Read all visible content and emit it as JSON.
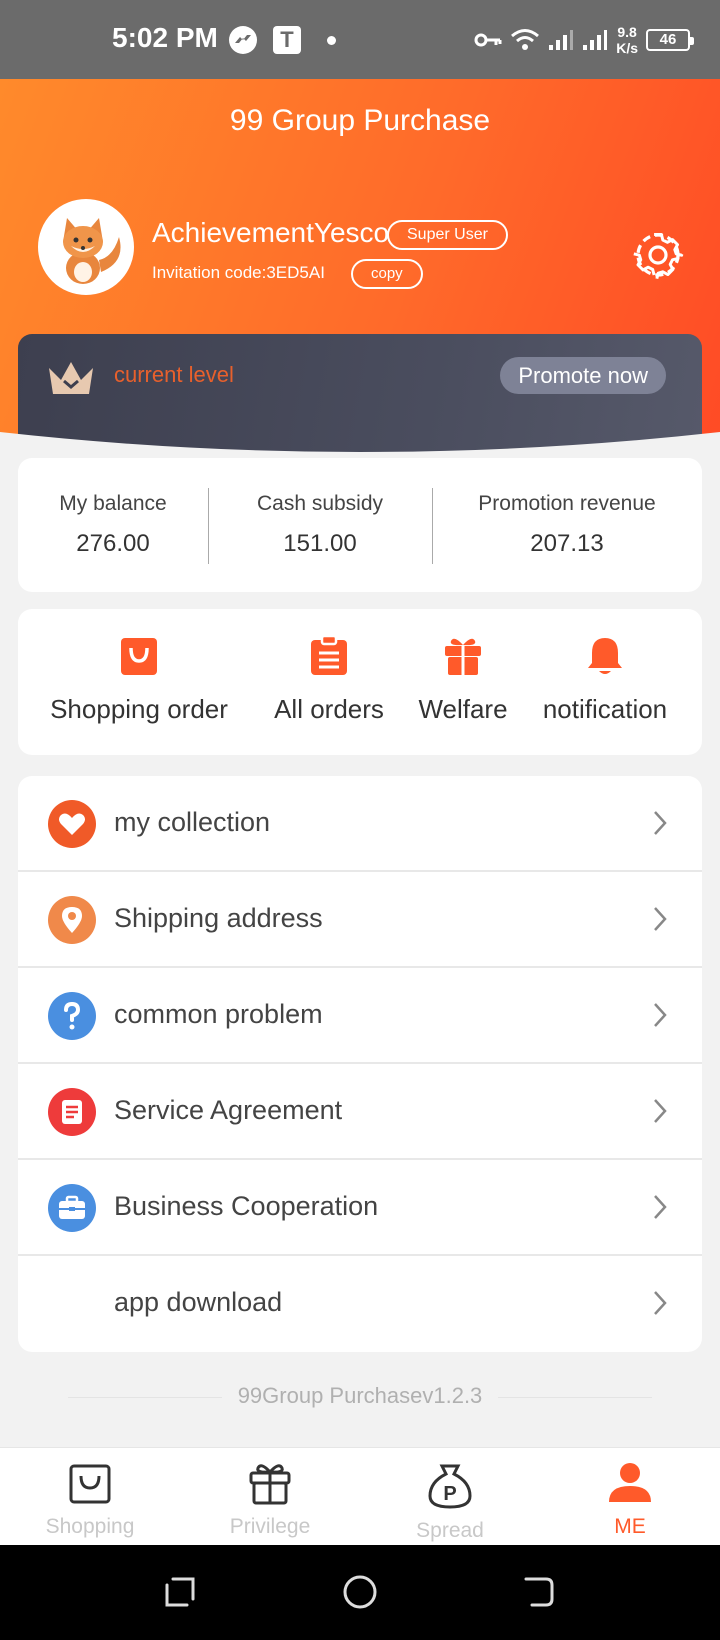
{
  "status_bar": {
    "time": "5:02 PM",
    "t_badge": "T",
    "net_speed_value": "9.8",
    "net_speed_unit": "K/s",
    "battery": "46"
  },
  "header": {
    "title": "99 Group Purchase",
    "username": "AchievementYesco",
    "user_badge": "Super User",
    "invitation_code": "Invitation code:3ED5AI",
    "copy_label": "copy"
  },
  "level_card": {
    "level_text": "current level",
    "promote_label": "Promote now"
  },
  "stats": [
    {
      "label": "My balance",
      "value": "276.00"
    },
    {
      "label": "Cash subsidy",
      "value": "151.00"
    },
    {
      "label": "Promotion revenue",
      "value": "207.13"
    }
  ],
  "shortcuts": [
    {
      "label": "Shopping order",
      "icon": "shopping-bag-icon"
    },
    {
      "label": "All orders",
      "icon": "clipboard-icon"
    },
    {
      "label": "Welfare",
      "icon": "gift-icon"
    },
    {
      "label": "notification",
      "icon": "bell-icon"
    }
  ],
  "menu": [
    {
      "label": "my collection",
      "icon": "heart-icon",
      "color": "#f05a28"
    },
    {
      "label": "Shipping address",
      "icon": "location-pin-icon",
      "color": "#f0894a"
    },
    {
      "label": "common problem",
      "icon": "question-icon",
      "color": "#4a8fe0"
    },
    {
      "label": "Service Agreement",
      "icon": "document-icon",
      "color": "#ee3b3b"
    },
    {
      "label": "Business Cooperation",
      "icon": "briefcase-icon",
      "color": "#4a8fe0"
    },
    {
      "label": "app download",
      "icon": "",
      "color": ""
    }
  ],
  "version": "99Group Purchasev1.2.3",
  "tabs": [
    {
      "label": "Shopping",
      "active": false
    },
    {
      "label": "Privilege",
      "active": false
    },
    {
      "label": "Spread",
      "active": false
    },
    {
      "label": "ME",
      "active": true
    }
  ],
  "colors": {
    "accent": "#ff5a2a",
    "header_gradient_start": "#ff8a2b",
    "header_gradient_end": "#ff4a25",
    "level_card": "#3d3f4f"
  }
}
